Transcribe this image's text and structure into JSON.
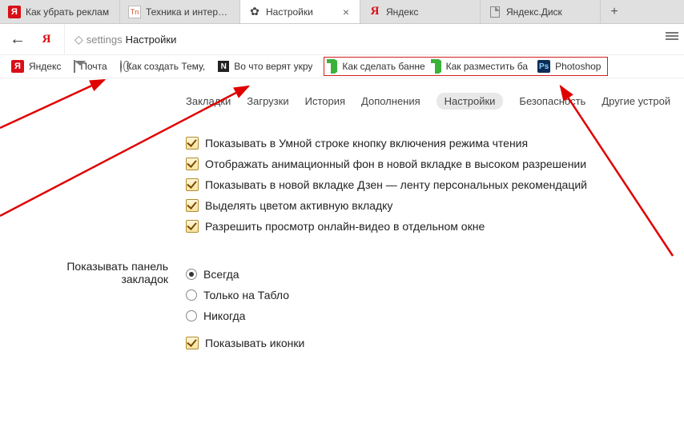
{
  "tabs": [
    {
      "label": "Как убрать реклам",
      "icon": "ya"
    },
    {
      "label": "Техника и интернет",
      "icon": "tn"
    },
    {
      "label": "Настройки",
      "icon": "gear",
      "active": true
    },
    {
      "label": "Яндекс",
      "icon": "ya-red"
    },
    {
      "label": "Яндекс.Диск",
      "icon": "file"
    }
  ],
  "address": {
    "key": "settings",
    "title": "Настройки"
  },
  "bookmarks": {
    "left": [
      {
        "label": "Яндекс",
        "icon": "ya"
      },
      {
        "label": "Почта",
        "icon": "mail"
      },
      {
        "label": "Как создать Тему,",
        "icon": "globe"
      },
      {
        "label": "Во что верят укру",
        "icon": "n"
      }
    ],
    "boxed": [
      {
        "label": "Как сделать банне",
        "icon": "arrow-g"
      },
      {
        "label": "Как разместить ба",
        "icon": "arrow-g"
      },
      {
        "label": "Photoshop",
        "icon": "ps"
      }
    ]
  },
  "subnav": {
    "items": [
      "Закладки",
      "Загрузки",
      "История",
      "Дополнения",
      "Настройки",
      "Безопасность",
      "Другие устрой"
    ],
    "active_index": 4
  },
  "settings": {
    "checks": [
      "Показывать в Умной строке кнопку включения режима чтения",
      "Отображать анимационный фон в новой вкладке в высоком разрешении",
      "Показывать в новой вкладке Дзен — ленту персональных рекомендаций",
      "Выделять цветом активную вкладку",
      "Разрешить просмотр онлайн-видео в отдельном окне"
    ],
    "bookmark_panel": {
      "label": "Показывать панель закладок",
      "options": [
        "Всегда",
        "Только на Табло",
        "Никогда"
      ],
      "selected": 0,
      "show_icons": "Показывать иконки"
    }
  }
}
